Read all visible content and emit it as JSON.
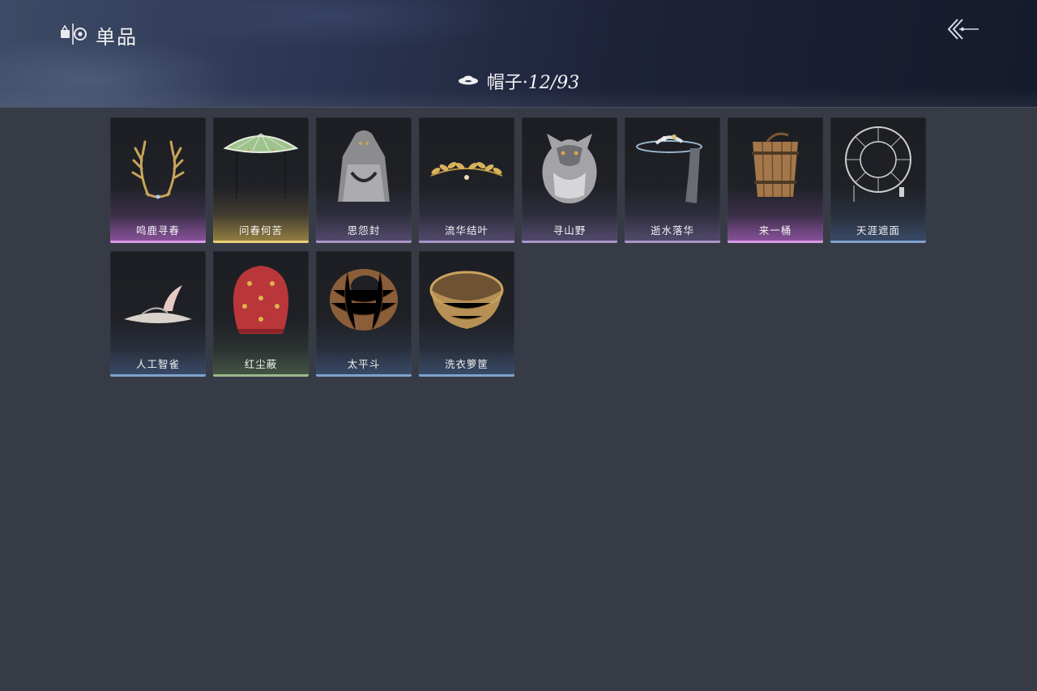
{
  "header": {
    "title": "单品",
    "title_icon": "wardrobe-icon",
    "back_icon": "back-arrows-icon"
  },
  "category": {
    "icon": "hat-icon",
    "label": "帽子·",
    "count": "12/93"
  },
  "rarity_colors": {
    "purple": "#d79ae6",
    "light_purple": "#a995c8",
    "gold": "#e9cf78",
    "blue": "#7fa2cc",
    "green": "#9bb98b"
  },
  "items": [
    {
      "name": "鸣鹿寻春",
      "icon": "antler-crown-icon",
      "rarity": "purple"
    },
    {
      "name": "问春何苦",
      "icon": "green-bamboo-hat-icon",
      "rarity": "gold"
    },
    {
      "name": "思怨封",
      "icon": "veiled-hood-icon",
      "rarity": "light_purple"
    },
    {
      "name": "流华结叶",
      "icon": "golden-leaf-wreath-icon",
      "rarity": "light_purple"
    },
    {
      "name": "寻山野",
      "icon": "wolf-hood-icon",
      "rarity": "light_purple"
    },
    {
      "name": "逝水落华",
      "icon": "veiled-flower-hat-icon",
      "rarity": "light_purple"
    },
    {
      "name": "来一桶",
      "icon": "wooden-bucket-icon",
      "rarity": "purple"
    },
    {
      "name": "天涯遮面",
      "icon": "wireframe-hat-icon",
      "rarity": "blue"
    },
    {
      "name": "人工智雀",
      "icon": "bird-hat-icon",
      "rarity": "blue"
    },
    {
      "name": "红尘蔽",
      "icon": "red-hood-icon",
      "rarity": "green"
    },
    {
      "name": "太平斗",
      "icon": "wicker-basket-hat-icon",
      "rarity": "blue"
    },
    {
      "name": "洗衣箩筐",
      "icon": "laundry-basket-icon",
      "rarity": "blue"
    }
  ]
}
